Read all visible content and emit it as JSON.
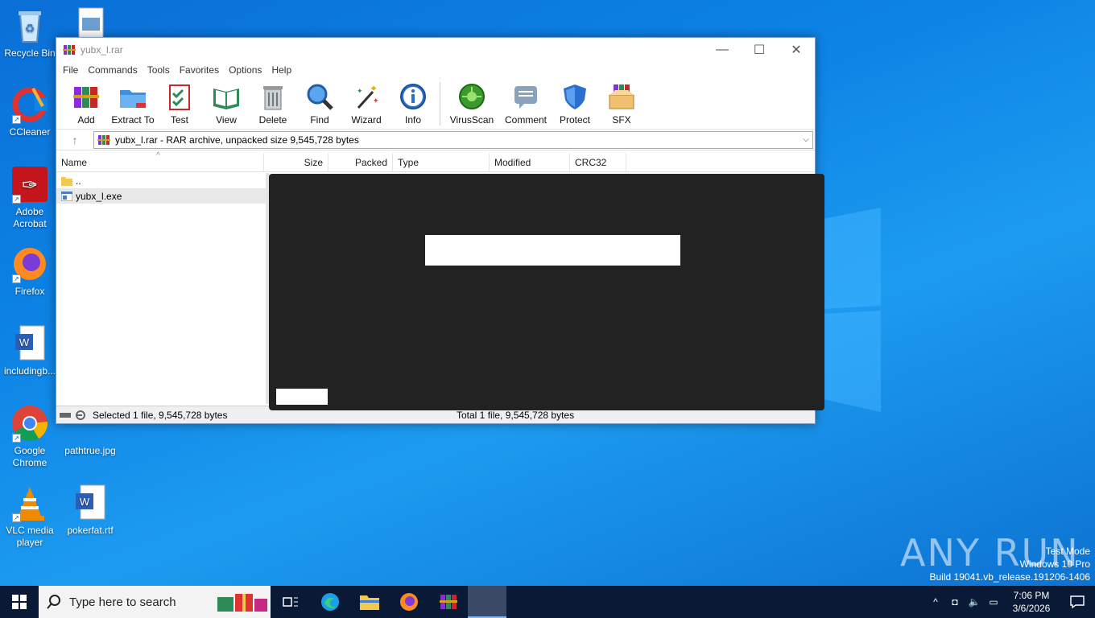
{
  "desktop": {
    "icons": [
      {
        "label": "Recycle Bin"
      },
      {
        "label": "CCleaner"
      },
      {
        "label": "Adobe Acrobat"
      },
      {
        "label": "Firefox"
      },
      {
        "label": "includingb..."
      },
      {
        "label": "Google Chrome"
      },
      {
        "label": "VLC media player"
      },
      {
        "label": "pathtrue.jpg"
      },
      {
        "label": "pokerfat.rtf"
      }
    ]
  },
  "window": {
    "title": "yubx_l.rar",
    "menu": [
      "File",
      "Commands",
      "Tools",
      "Favorites",
      "Options",
      "Help"
    ],
    "toolbar": [
      {
        "label": "Add",
        "icon": "add-icon"
      },
      {
        "label": "Extract To",
        "icon": "extract-icon"
      },
      {
        "label": "Test",
        "icon": "test-icon"
      },
      {
        "label": "View",
        "icon": "view-icon"
      },
      {
        "label": "Delete",
        "icon": "delete-icon"
      },
      {
        "label": "Find",
        "icon": "find-icon"
      },
      {
        "label": "Wizard",
        "icon": "wizard-icon"
      },
      {
        "label": "Info",
        "icon": "info-icon"
      },
      {
        "label": "VirusScan",
        "icon": "virusscan-icon"
      },
      {
        "label": "Comment",
        "icon": "comment-icon"
      },
      {
        "label": "Protect",
        "icon": "protect-icon"
      },
      {
        "label": "SFX",
        "icon": "sfx-icon"
      }
    ],
    "address": "yubx_l.rar - RAR archive, unpacked size 9,545,728 bytes",
    "columns": [
      "Name",
      "Size",
      "Packed",
      "Type",
      "Modified",
      "CRC32"
    ],
    "rows": [
      {
        "name": ".."
      },
      {
        "name": "yubx_l.exe"
      }
    ],
    "status_left": "Selected 1 file, 9,545,728 bytes",
    "status_right": "Total 1 file, 9,545,728 bytes"
  },
  "taskbar": {
    "search_placeholder": "Type here to search",
    "time": "7:06 PM",
    "date": "3/6/2026"
  },
  "watermark": {
    "brand": "ANY RUN",
    "line1": "Test Mode",
    "line2": "Windows 10 Pro",
    "line3": "Build 19041.vb_release.191206-1406"
  }
}
